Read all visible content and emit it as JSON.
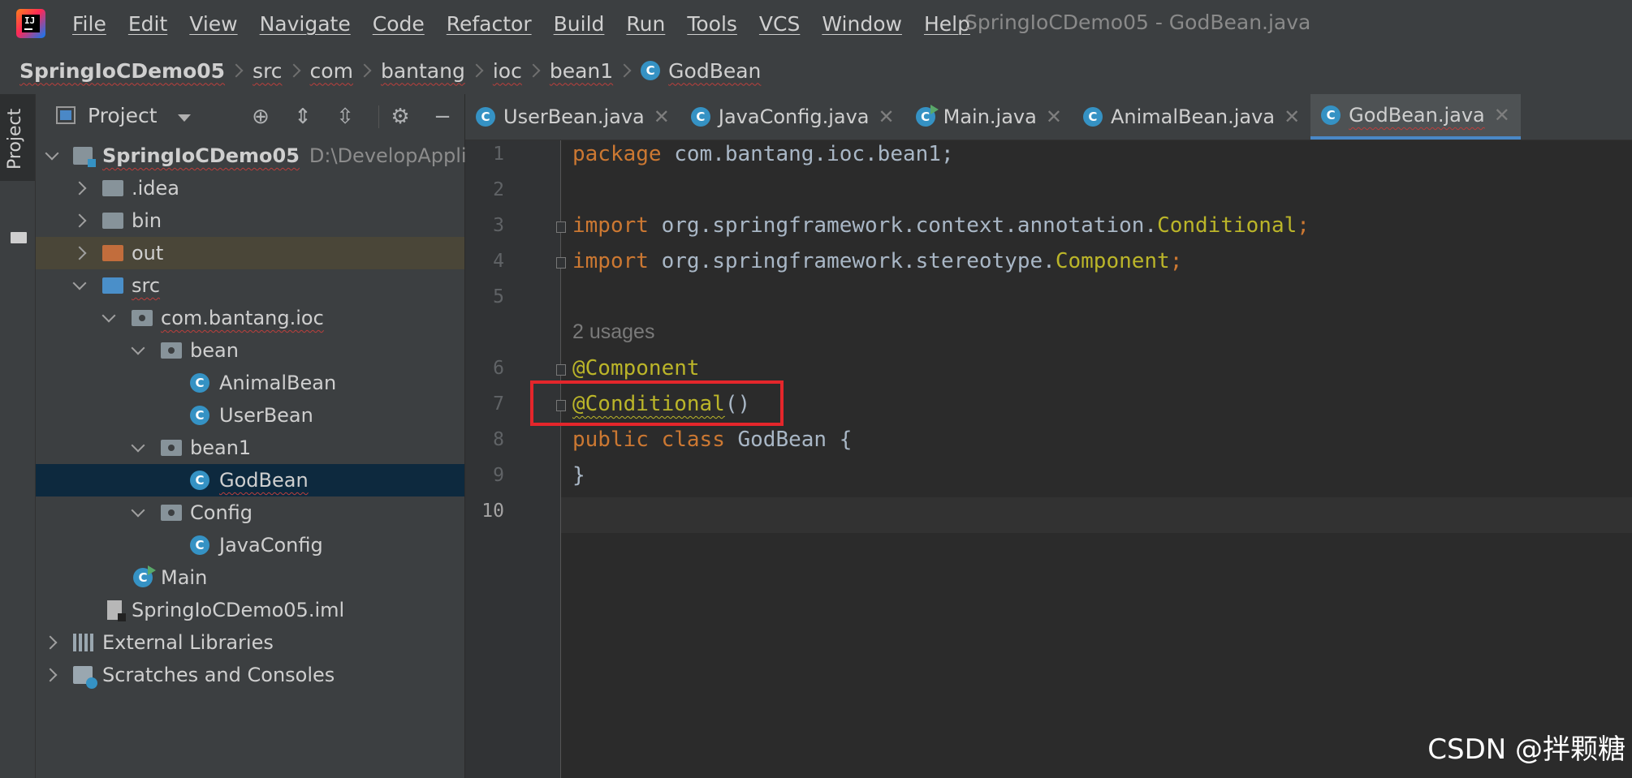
{
  "menu": {
    "items": [
      "File",
      "Edit",
      "View",
      "Navigate",
      "Code",
      "Refactor",
      "Build",
      "Run",
      "Tools",
      "VCS",
      "Window",
      "Help"
    ],
    "window_title": "SpringIoCDemo05 - GodBean.java"
  },
  "breadcrumb": [
    "SpringIoCDemo05",
    "src",
    "com",
    "bantang",
    "ioc",
    "bean1",
    "GodBean"
  ],
  "stripe": {
    "project_label": "Project"
  },
  "project_panel": {
    "title": "Project",
    "tree": [
      {
        "label": "SpringIoCDemo05",
        "path": "D:\\DevelopApplica"
      },
      {
        "label": ".idea"
      },
      {
        "label": "bin"
      },
      {
        "label": "out"
      },
      {
        "label": "src"
      },
      {
        "label": "com.bantang.ioc"
      },
      {
        "label": "bean"
      },
      {
        "label": "AnimalBean"
      },
      {
        "label": "UserBean"
      },
      {
        "label": "bean1"
      },
      {
        "label": "GodBean"
      },
      {
        "label": "Config"
      },
      {
        "label": "JavaConfig"
      },
      {
        "label": "Main"
      },
      {
        "label": "SpringIoCDemo05.iml"
      },
      {
        "label": "External Libraries"
      },
      {
        "label": "Scratches and Consoles"
      }
    ]
  },
  "tabs": [
    {
      "label": "UserBean.java"
    },
    {
      "label": "JavaConfig.java"
    },
    {
      "label": "Main.java"
    },
    {
      "label": "AnimalBean.java"
    },
    {
      "label": "GodBean.java"
    }
  ],
  "editor": {
    "line_numbers": [
      "1",
      "2",
      "3",
      "4",
      "5",
      "6",
      "7",
      "8",
      "9",
      "10"
    ],
    "usages_hint": "2 usages",
    "code": {
      "l1_kw": "package",
      "l1_rest": " com.bantang.ioc.bean1;",
      "l3_kw": "import",
      "l3_rest": " org.springframework.context.annotation.",
      "l3_cls": "Conditional",
      "l3_end": ";",
      "l4_kw": "import",
      "l4_rest": " org.springframework.stereotype.",
      "l4_cls": "Component",
      "l4_end": ";",
      "l6_anno": "@Component",
      "l7_anno": "@Conditional",
      "l7_rest": "()",
      "l8_kw1": "public",
      "l8_kw2": " class",
      "l8_rest": " GodBean {",
      "l9": "}"
    }
  },
  "watermark": "CSDN @拌颗糖",
  "colors": {
    "accent": "#4a88c7",
    "highlight_box": "#e4262b",
    "keyword": "#cc7832",
    "annotation": "#bbb529"
  }
}
